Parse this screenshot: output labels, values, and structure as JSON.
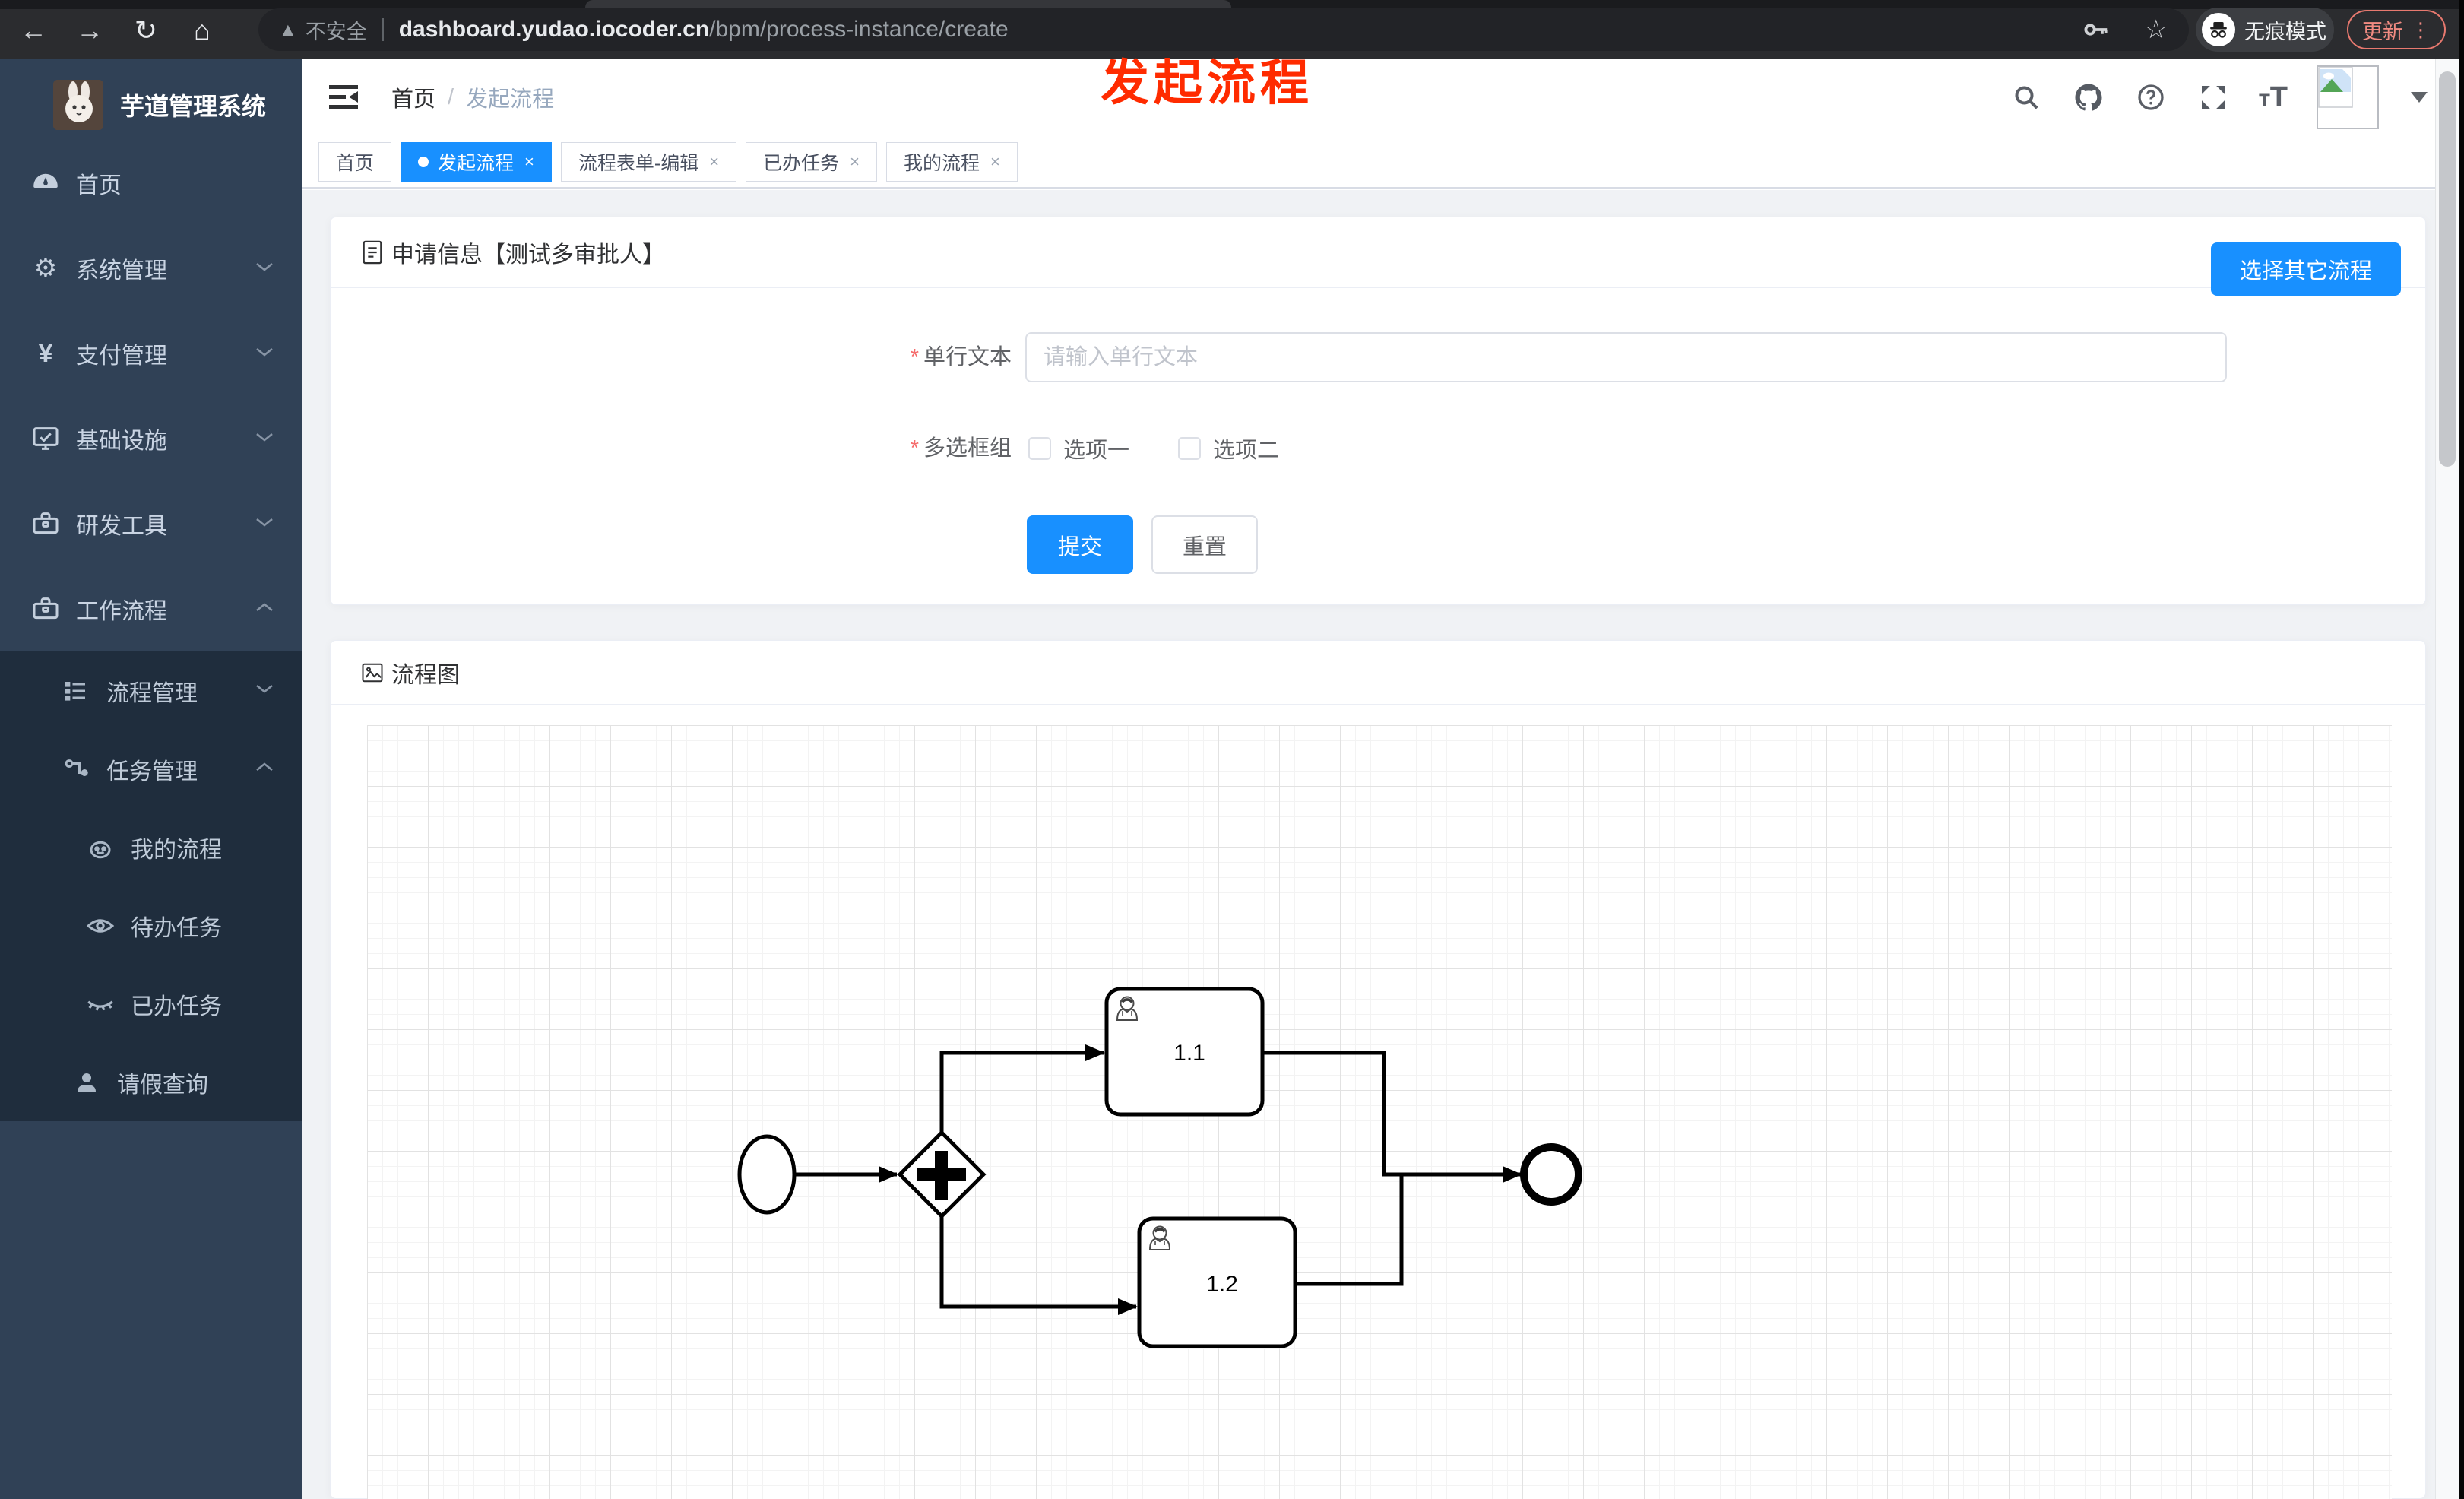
{
  "browser": {
    "security_label": "不安全",
    "url_domain": "dashboard.yudao.iocoder.cn",
    "url_path": "/bpm/process-instance/create",
    "incognito_label": "无痕模式",
    "update_label": "更新"
  },
  "annotation": {
    "text": "发起流程",
    "color": "#ff2b00"
  },
  "sidebar": {
    "title": "芋道管理系统",
    "items": [
      {
        "label": "首页",
        "icon": "gauge-icon"
      },
      {
        "label": "系统管理",
        "icon": "gear-icon",
        "chevron": "down"
      },
      {
        "label": "支付管理",
        "icon": "yuan-icon",
        "chevron": "down"
      },
      {
        "label": "基础设施",
        "icon": "monitor-icon",
        "chevron": "down"
      },
      {
        "label": "研发工具",
        "icon": "toolbox-icon",
        "chevron": "down"
      },
      {
        "label": "工作流程",
        "icon": "toolbox-icon",
        "chevron": "up"
      }
    ],
    "submenu": [
      {
        "label": "流程管理",
        "icon": "list-icon",
        "chevron": "down"
      },
      {
        "label": "任务管理",
        "icon": "flow-icon",
        "chevron": "up"
      },
      {
        "label": "我的流程",
        "icon": "face-icon"
      },
      {
        "label": "待办任务",
        "icon": "eye-icon"
      },
      {
        "label": "已办任务",
        "icon": "eye-closed-icon"
      },
      {
        "label": "请假查询",
        "icon": "user-icon"
      }
    ]
  },
  "header": {
    "breadcrumb": [
      "首页",
      "发起流程"
    ]
  },
  "tabs": [
    {
      "label": "首页",
      "active": false,
      "closable": false
    },
    {
      "label": "发起流程",
      "active": true,
      "closable": true
    },
    {
      "label": "流程表单-编辑",
      "active": false,
      "closable": true
    },
    {
      "label": "已办任务",
      "active": false,
      "closable": true
    },
    {
      "label": "我的流程",
      "active": false,
      "closable": true
    }
  ],
  "form_card": {
    "title": "申请信息【测试多审批人】",
    "action_button": "选择其它流程",
    "text_field": {
      "label": "单行文本",
      "placeholder": "请输入单行文本",
      "value": "",
      "required": true
    },
    "checkbox_group": {
      "label": "多选框组",
      "required": true,
      "options": [
        {
          "label": "选项一",
          "checked": false
        },
        {
          "label": "选项二",
          "checked": false
        }
      ]
    },
    "submit_label": "提交",
    "reset_label": "重置"
  },
  "diagram_card": {
    "title": "流程图",
    "nodes": {
      "start": "start-event",
      "gateway": "parallel-gateway",
      "task1": "1.1",
      "task2": "1.2",
      "end": "end-event"
    }
  },
  "colors": {
    "primary": "#1890ff",
    "sidebar_bg": "#304156",
    "submenu_bg": "#1f2d3d",
    "annotation": "#ff2b00"
  }
}
